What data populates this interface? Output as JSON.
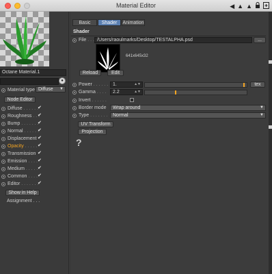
{
  "window": {
    "title": "Material Editor"
  },
  "material": {
    "name": "Octane Material.1",
    "type_label": "Material type",
    "type_value": "Diffuse",
    "node_editor_label": "Node Editor",
    "show_in_help_label": "Show in Help",
    "assignment_label": "Assignment . . .",
    "channels": [
      {
        "label": "Diffuse",
        "dots": ". . . . . .",
        "checked": true,
        "active": false
      },
      {
        "label": "Roughness",
        "dots": ". . .",
        "checked": true,
        "active": false
      },
      {
        "label": "Bump",
        "dots": ". . . . . . .",
        "checked": true,
        "active": false
      },
      {
        "label": "Normal",
        "dots": ". . . . . .",
        "checked": true,
        "active": false
      },
      {
        "label": "Displacement",
        "dots": "",
        "checked": true,
        "active": false
      },
      {
        "label": "Opacity",
        "dots": ". . . . .",
        "checked": true,
        "active": true
      },
      {
        "label": "Transmission",
        "dots": "",
        "checked": true,
        "active": false
      },
      {
        "label": "Emission",
        "dots": ". . . .",
        "checked": true,
        "active": false
      },
      {
        "label": "Medium",
        "dots": ". . . . .",
        "checked": true,
        "active": false
      },
      {
        "label": "Common",
        "dots": ". . . .",
        "checked": true,
        "active": false
      },
      {
        "label": "Editor",
        "dots": ". . . . . . .",
        "checked": true,
        "active": false
      }
    ]
  },
  "tabs": [
    {
      "label": "Basic",
      "selected": false
    },
    {
      "label": "Shader",
      "selected": true
    },
    {
      "label": "Animation",
      "selected": false
    }
  ],
  "shader": {
    "section_title": "Shader",
    "file_label": "File",
    "file_dots": ". . . .",
    "file_path": "/Users/raoulmarks/Desktop/TESTALPHA.psd",
    "file_browse_label": "...",
    "image_info": "641x645x32",
    "reload_label": "Reload",
    "edit_label": "Edit",
    "power_label": "Power",
    "power_dots": ". . . . . .",
    "power_value": "1.",
    "power_slider_fraction": 0.98,
    "tex_label": "tex",
    "gamma_label": "Gamma",
    "gamma_dots": ". . . .",
    "gamma_value": "2.2",
    "gamma_slider_fraction": 0.3,
    "invert_label": "Invert",
    "invert_dots": ". . . . . .",
    "invert_checked": false,
    "border_mode_label": "Border mode",
    "border_mode_value": "Wrap around",
    "type_label": "Type",
    "type_dots": ". . . . . . .",
    "type_value": "Normal",
    "uv_transform_label": "UV Transform",
    "projection_label": "Projection",
    "help_glyph": "?"
  },
  "toolbar_icons": [
    "arrow-left-icon",
    "arrow-up-icon",
    "triangle-icon",
    "lock-icon",
    "new-window-icon"
  ],
  "colors": {
    "accent": "#f6a623",
    "tab_selected": "#5b7fb0"
  }
}
